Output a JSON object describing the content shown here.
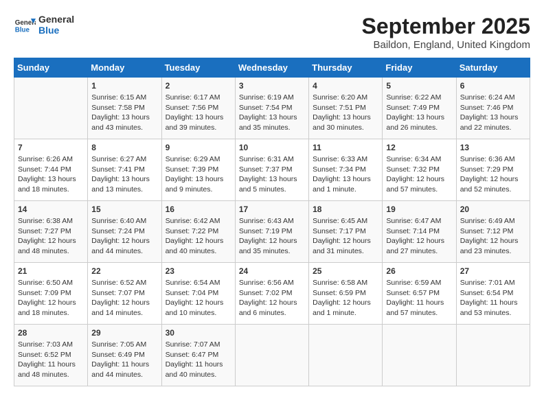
{
  "header": {
    "logo_line1": "General",
    "logo_line2": "Blue",
    "month_title": "September 2025",
    "location": "Baildon, England, United Kingdom"
  },
  "weekdays": [
    "Sunday",
    "Monday",
    "Tuesday",
    "Wednesday",
    "Thursday",
    "Friday",
    "Saturday"
  ],
  "weeks": [
    [
      {
        "day": "",
        "content": ""
      },
      {
        "day": "1",
        "content": "Sunrise: 6:15 AM\nSunset: 7:58 PM\nDaylight: 13 hours\nand 43 minutes."
      },
      {
        "day": "2",
        "content": "Sunrise: 6:17 AM\nSunset: 7:56 PM\nDaylight: 13 hours\nand 39 minutes."
      },
      {
        "day": "3",
        "content": "Sunrise: 6:19 AM\nSunset: 7:54 PM\nDaylight: 13 hours\nand 35 minutes."
      },
      {
        "day": "4",
        "content": "Sunrise: 6:20 AM\nSunset: 7:51 PM\nDaylight: 13 hours\nand 30 minutes."
      },
      {
        "day": "5",
        "content": "Sunrise: 6:22 AM\nSunset: 7:49 PM\nDaylight: 13 hours\nand 26 minutes."
      },
      {
        "day": "6",
        "content": "Sunrise: 6:24 AM\nSunset: 7:46 PM\nDaylight: 13 hours\nand 22 minutes."
      }
    ],
    [
      {
        "day": "7",
        "content": "Sunrise: 6:26 AM\nSunset: 7:44 PM\nDaylight: 13 hours\nand 18 minutes."
      },
      {
        "day": "8",
        "content": "Sunrise: 6:27 AM\nSunset: 7:41 PM\nDaylight: 13 hours\nand 13 minutes."
      },
      {
        "day": "9",
        "content": "Sunrise: 6:29 AM\nSunset: 7:39 PM\nDaylight: 13 hours\nand 9 minutes."
      },
      {
        "day": "10",
        "content": "Sunrise: 6:31 AM\nSunset: 7:37 PM\nDaylight: 13 hours\nand 5 minutes."
      },
      {
        "day": "11",
        "content": "Sunrise: 6:33 AM\nSunset: 7:34 PM\nDaylight: 13 hours\nand 1 minute."
      },
      {
        "day": "12",
        "content": "Sunrise: 6:34 AM\nSunset: 7:32 PM\nDaylight: 12 hours\nand 57 minutes."
      },
      {
        "day": "13",
        "content": "Sunrise: 6:36 AM\nSunset: 7:29 PM\nDaylight: 12 hours\nand 52 minutes."
      }
    ],
    [
      {
        "day": "14",
        "content": "Sunrise: 6:38 AM\nSunset: 7:27 PM\nDaylight: 12 hours\nand 48 minutes."
      },
      {
        "day": "15",
        "content": "Sunrise: 6:40 AM\nSunset: 7:24 PM\nDaylight: 12 hours\nand 44 minutes."
      },
      {
        "day": "16",
        "content": "Sunrise: 6:42 AM\nSunset: 7:22 PM\nDaylight: 12 hours\nand 40 minutes."
      },
      {
        "day": "17",
        "content": "Sunrise: 6:43 AM\nSunset: 7:19 PM\nDaylight: 12 hours\nand 35 minutes."
      },
      {
        "day": "18",
        "content": "Sunrise: 6:45 AM\nSunset: 7:17 PM\nDaylight: 12 hours\nand 31 minutes."
      },
      {
        "day": "19",
        "content": "Sunrise: 6:47 AM\nSunset: 7:14 PM\nDaylight: 12 hours\nand 27 minutes."
      },
      {
        "day": "20",
        "content": "Sunrise: 6:49 AM\nSunset: 7:12 PM\nDaylight: 12 hours\nand 23 minutes."
      }
    ],
    [
      {
        "day": "21",
        "content": "Sunrise: 6:50 AM\nSunset: 7:09 PM\nDaylight: 12 hours\nand 18 minutes."
      },
      {
        "day": "22",
        "content": "Sunrise: 6:52 AM\nSunset: 7:07 PM\nDaylight: 12 hours\nand 14 minutes."
      },
      {
        "day": "23",
        "content": "Sunrise: 6:54 AM\nSunset: 7:04 PM\nDaylight: 12 hours\nand 10 minutes."
      },
      {
        "day": "24",
        "content": "Sunrise: 6:56 AM\nSunset: 7:02 PM\nDaylight: 12 hours\nand 6 minutes."
      },
      {
        "day": "25",
        "content": "Sunrise: 6:58 AM\nSunset: 6:59 PM\nDaylight: 12 hours\nand 1 minute."
      },
      {
        "day": "26",
        "content": "Sunrise: 6:59 AM\nSunset: 6:57 PM\nDaylight: 11 hours\nand 57 minutes."
      },
      {
        "day": "27",
        "content": "Sunrise: 7:01 AM\nSunset: 6:54 PM\nDaylight: 11 hours\nand 53 minutes."
      }
    ],
    [
      {
        "day": "28",
        "content": "Sunrise: 7:03 AM\nSunset: 6:52 PM\nDaylight: 11 hours\nand 48 minutes."
      },
      {
        "day": "29",
        "content": "Sunrise: 7:05 AM\nSunset: 6:49 PM\nDaylight: 11 hours\nand 44 minutes."
      },
      {
        "day": "30",
        "content": "Sunrise: 7:07 AM\nSunset: 6:47 PM\nDaylight: 11 hours\nand 40 minutes."
      },
      {
        "day": "",
        "content": ""
      },
      {
        "day": "",
        "content": ""
      },
      {
        "day": "",
        "content": ""
      },
      {
        "day": "",
        "content": ""
      }
    ]
  ]
}
